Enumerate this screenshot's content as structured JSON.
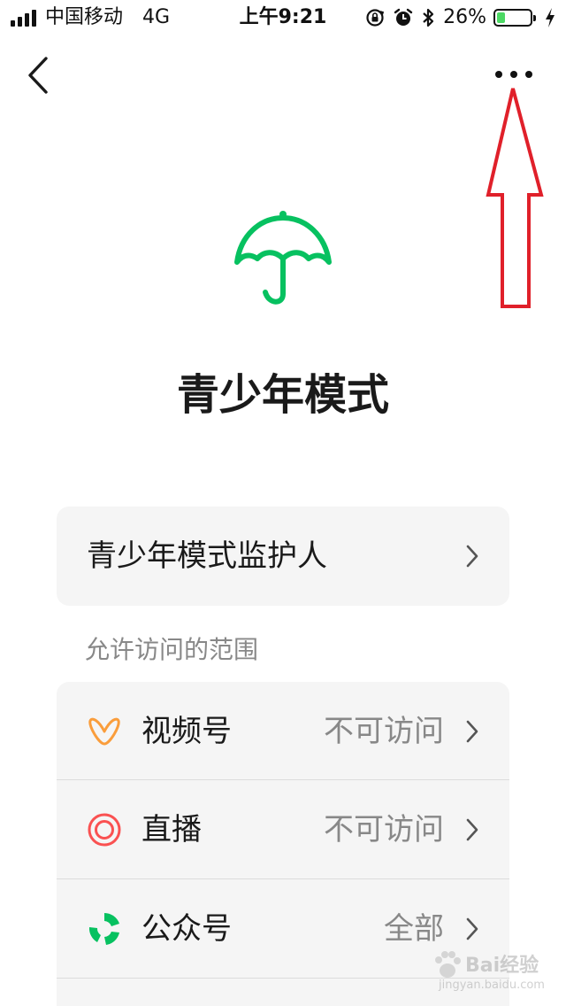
{
  "status_bar": {
    "carrier": "中国移动",
    "network": "4G",
    "time": "上午9:21",
    "battery_percent": "26%",
    "battery_level": 0.26,
    "icons": [
      "signal-icon",
      "rotation-lock-icon",
      "alarm-icon",
      "bluetooth-icon",
      "battery-icon",
      "charging-icon"
    ]
  },
  "nav": {
    "back_icon": "chevron-left-icon",
    "more_icon": "more-dots-icon"
  },
  "header": {
    "icon": "umbrella-icon",
    "title": "青少年模式"
  },
  "guardian": {
    "label": "青少年模式监护人"
  },
  "scope": {
    "section_label": "允许访问的范围",
    "items": [
      {
        "icon": "channels-icon",
        "label": "视频号",
        "value": "不可访问"
      },
      {
        "icon": "live-icon",
        "label": "直播",
        "value": "不可访问"
      },
      {
        "icon": "official-accounts-icon",
        "label": "公众号",
        "value": "全部"
      }
    ]
  },
  "watermark": {
    "logo_text": "Bai经验",
    "url_text": "jingyan.baidu.com"
  },
  "colors": {
    "accent_green": "#07c160",
    "channels_orange": "#fa9d3b",
    "live_red": "#fa5151",
    "annotation_red": "#e0202a",
    "card_bg": "#f5f5f5",
    "secondary_text": "#888888"
  }
}
